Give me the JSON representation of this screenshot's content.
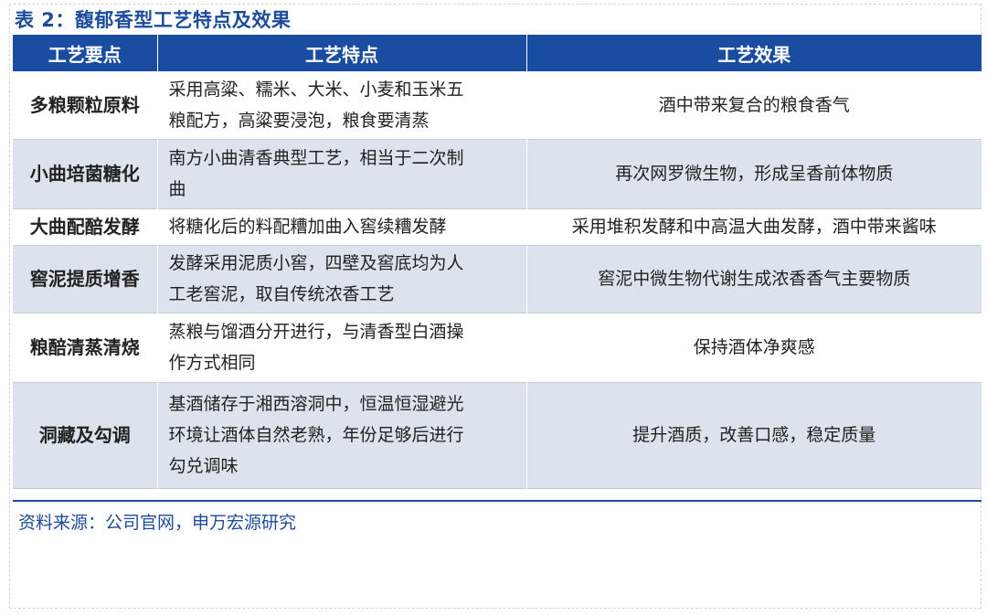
{
  "title": "表 2：馥郁香型工艺特点及效果",
  "table": {
    "headers": [
      "工艺要点",
      "工艺特点",
      "工艺效果"
    ],
    "rows": [
      {
        "point": "多粮颗粒原料",
        "feature_lines": [
          "采用高粱、糯米、大米、小麦和玉米五",
          "粮配方，高粱要浸泡，粮食要清蒸"
        ],
        "effect": "酒中带来复合的粮食香气"
      },
      {
        "point": "小曲培菌糖化",
        "feature_lines": [
          "南方小曲清香典型工艺，相当于二次制",
          "曲"
        ],
        "effect": "再次网罗微生物，形成呈香前体物质"
      },
      {
        "point": "大曲配醅发酵",
        "feature_lines": [
          "将糖化后的料配糟加曲入窖续糟发酵"
        ],
        "effect": "采用堆积发酵和中高温大曲发酵，酒中带来酱味"
      },
      {
        "point": "窖泥提质增香",
        "feature_lines": [
          "发酵采用泥质小窖，四壁及窖底均为人",
          "工老窖泥，取自传统浓香工艺"
        ],
        "effect": "窖泥中微生物代谢生成浓香香气主要物质"
      },
      {
        "point": "粮醅清蒸清烧",
        "feature_lines": [
          "蒸粮与馏酒分开进行，与清香型白酒操",
          "作方式相同"
        ],
        "effect": "保持酒体净爽感"
      },
      {
        "point": "洞藏及勾调",
        "feature_lines": [
          "基酒储存于湘西溶洞中，恒温恒湿避光",
          "环境让酒体自然老熟，年份足够后进行",
          "勾兑调味"
        ],
        "effect": "提升酒质，改善口感，稳定质量"
      }
    ]
  },
  "source": "资料来源：公司官网，申万宏源研究",
  "colors": {
    "header_bg": "#1a4da1",
    "title_text": "#1d4c9a",
    "stripe": "#dce3ec"
  }
}
